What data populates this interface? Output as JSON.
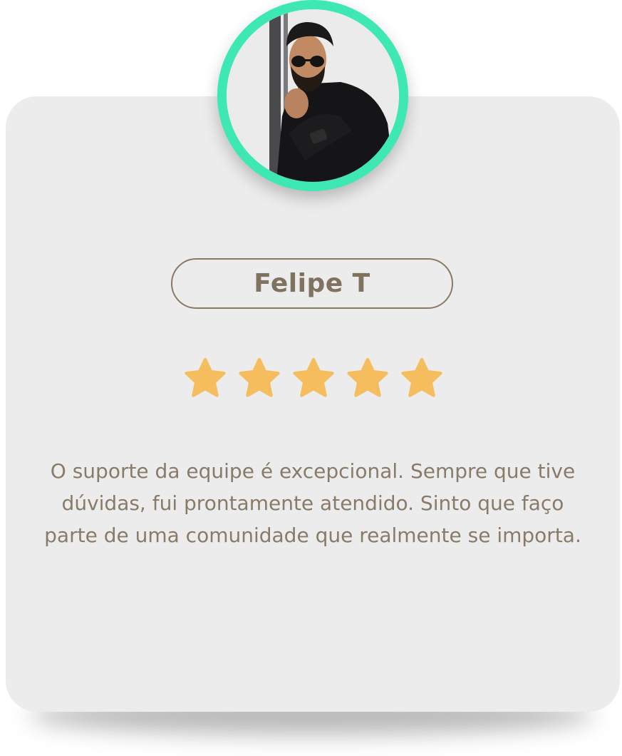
{
  "testimonial": {
    "name": "Felipe T",
    "rating": 5,
    "rating_max": 5,
    "quote": "O suporte da equipe é excepcional. Sempre que tive dúvidas, fui prontamente atendido. Sinto que faço parte de uma comunidade que realmente se importa."
  },
  "colors": {
    "card_background": "#ececec",
    "avatar_ring": "#3ee8b2",
    "name_text": "#7f725f",
    "name_border": "#8a7a65",
    "star": "#f5bd5d",
    "quote_text": "#887b69"
  },
  "icons": {
    "avatar": "user-photo",
    "star": "star-icon"
  }
}
